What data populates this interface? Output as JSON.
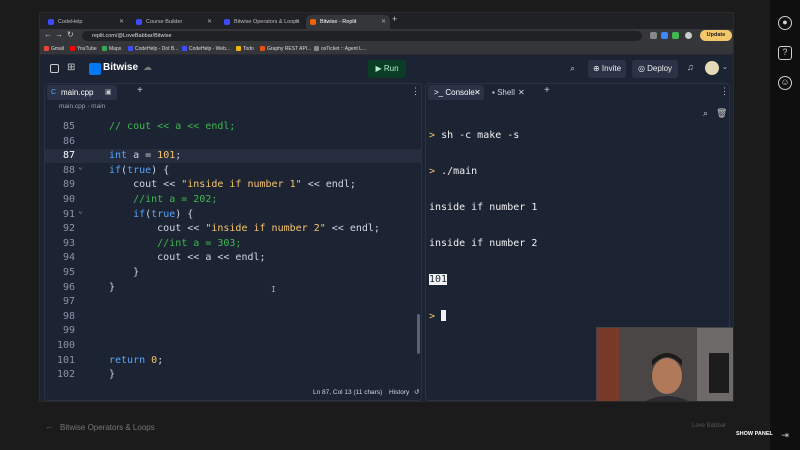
{
  "browser": {
    "tabs": [
      {
        "label": "CodeHelp",
        "active": false
      },
      {
        "label": "Course Builder",
        "active": false
      },
      {
        "label": "Bitwise Operators & Loops",
        "active": false
      },
      {
        "label": "Bitwise - Replit",
        "active": true
      }
    ],
    "url": "replit.com/@LoveBabbar/Bitwise",
    "update_label": "Update",
    "bookmarks": [
      "Gmail",
      "YouTube",
      "Maps",
      "CodeHelp - Dot B...",
      "CodeHelp - Web...",
      "Todo",
      "Graphy REST API...",
      "osTicket :: Agent L..."
    ]
  },
  "replit": {
    "project": "Bitwise",
    "run_label": "Run",
    "invite_label": "Invite",
    "deploy_label": "Deploy"
  },
  "editor": {
    "tab_label": "main.cpp",
    "breadcrumb": [
      "main.cpp",
      "main"
    ],
    "lines": [
      {
        "n": "85",
        "text": "// cout << a << endl;",
        "kind": "comment"
      },
      {
        "n": "86",
        "text": "",
        "kind": "plain"
      },
      {
        "n": "87",
        "text": "int a = 101;",
        "kind": "plain"
      },
      {
        "n": "88",
        "text": "if(true) {",
        "kind": "plain"
      },
      {
        "n": "89",
        "text": "    cout << \"inside if number 1\" << endl;",
        "kind": "plain"
      },
      {
        "n": "90",
        "text": "    //int a = 202;",
        "kind": "comment"
      },
      {
        "n": "91",
        "text": "    if(true) {",
        "kind": "plain"
      },
      {
        "n": "92",
        "text": "        cout << \"inside if number 2\" << endl;",
        "kind": "plain"
      },
      {
        "n": "93",
        "text": "        //int a = 303;",
        "kind": "comment"
      },
      {
        "n": "94",
        "text": "        cout << a << endl;",
        "kind": "plain"
      },
      {
        "n": "95",
        "text": "    }",
        "kind": "plain"
      },
      {
        "n": "96",
        "text": "}",
        "kind": "plain"
      },
      {
        "n": "97",
        "text": "",
        "kind": "plain"
      },
      {
        "n": "98",
        "text": "",
        "kind": "plain"
      },
      {
        "n": "99",
        "text": "",
        "kind": "plain"
      },
      {
        "n": "100",
        "text": "",
        "kind": "plain"
      },
      {
        "n": "101",
        "text": "return 0;",
        "kind": "plain"
      },
      {
        "n": "102",
        "text": "}",
        "kind": "plain"
      }
    ],
    "status": "Ln 87, Col 13 (11 chars)",
    "history_label": "History"
  },
  "console": {
    "tabs": [
      "Console",
      "Shell"
    ],
    "output": [
      {
        "prompt": ">",
        "text": "sh -c make -s"
      },
      {
        "prompt": ">",
        "text": "./main"
      },
      {
        "prompt": "",
        "text": "inside if number 1"
      },
      {
        "prompt": "",
        "text": "inside if number 2"
      },
      {
        "prompt": "",
        "text": "101"
      }
    ],
    "cursor_prompt": ">"
  },
  "footer": {
    "title": "Bitwise Operators & Loops",
    "show_panel": "SHOW PANEL",
    "user": "Love Babbar"
  },
  "colors": {
    "accent": "#0079f2",
    "run_bg": "#0b3d26",
    "comment": "#3fb950",
    "keyword": "#58a6ff",
    "string": "#f7c56b"
  }
}
